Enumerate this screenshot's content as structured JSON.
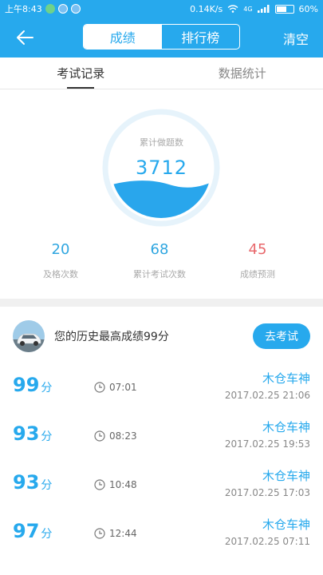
{
  "status_bar": {
    "time": "上午8:43",
    "speed": "0.14K/s",
    "network": "4G",
    "battery": "60%",
    "battery_level": 0.6
  },
  "header": {
    "segments": [
      "成绩",
      "排行榜"
    ],
    "active_segment": 0,
    "clear_label": "清空",
    "accent_color": "#27a9ed"
  },
  "tabs": [
    {
      "label": "考试记录",
      "active": true
    },
    {
      "label": "数据统计",
      "active": false
    }
  ],
  "summary": {
    "circle_label": "累计做题数",
    "circle_value": "3712",
    "stats": [
      {
        "value": "20",
        "label": "及格次数",
        "color": "#2fa6e0"
      },
      {
        "value": "68",
        "label": "累计考试次数",
        "color": "#2fa6e0"
      },
      {
        "value": "45",
        "label": "成绩预测",
        "color": "#e8676b"
      }
    ]
  },
  "best": {
    "text": "您的历史最高成绩99分",
    "button_label": "去考试"
  },
  "records": [
    {
      "score": "99",
      "unit": "分",
      "time": "07:01",
      "name": "木仓车神",
      "date": "2017.02.25  21:06"
    },
    {
      "score": "93",
      "unit": "分",
      "time": "08:23",
      "name": "木仓车神",
      "date": "2017.02.25  19:53"
    },
    {
      "score": "93",
      "unit": "分",
      "time": "10:48",
      "name": "木仓车神",
      "date": "2017.02.25  17:03"
    },
    {
      "score": "97",
      "unit": "分",
      "time": "12:44",
      "name": "木仓车神",
      "date": "2017.02.25  07:11"
    }
  ]
}
